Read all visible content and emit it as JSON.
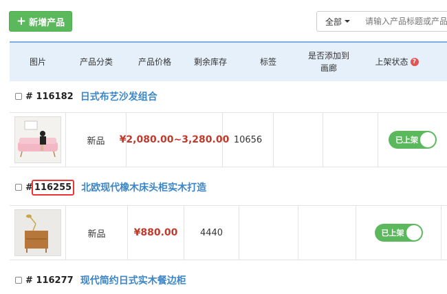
{
  "toolbar": {
    "add_label": "新增产品",
    "filter_label": "全部",
    "search_placeholder": "请输入产品标题或产品"
  },
  "table": {
    "headers": [
      "图片",
      "产品分类",
      "产品价格",
      "剩余库存",
      "标签",
      "是否添加到画廊",
      "上架状态"
    ],
    "gallery_header_line1": "是否添加到",
    "gallery_header_line2": "画廊",
    "help_glyph": "?"
  },
  "products": [
    {
      "id": "# 116182",
      "title": "日式布艺沙发组合",
      "category": "新品",
      "price": "¥2,080.00~3,280.00",
      "stock": "10656",
      "status": "已上架"
    },
    {
      "id_prefix": "#",
      "id": "116255",
      "title": "北欧现代橡木床头柜实木打造",
      "category": "新品",
      "price": "¥880.00",
      "stock": "4440",
      "status": "已上架"
    },
    {
      "id": "# 116277",
      "title": "现代简约日式实木餐边柜"
    }
  ],
  "colors": {
    "accent_green": "#5cb85c",
    "link_blue": "#3a86c8",
    "price_red": "#c0392b",
    "header_bg": "#e6f0fa",
    "highlight_red": "#e33"
  }
}
